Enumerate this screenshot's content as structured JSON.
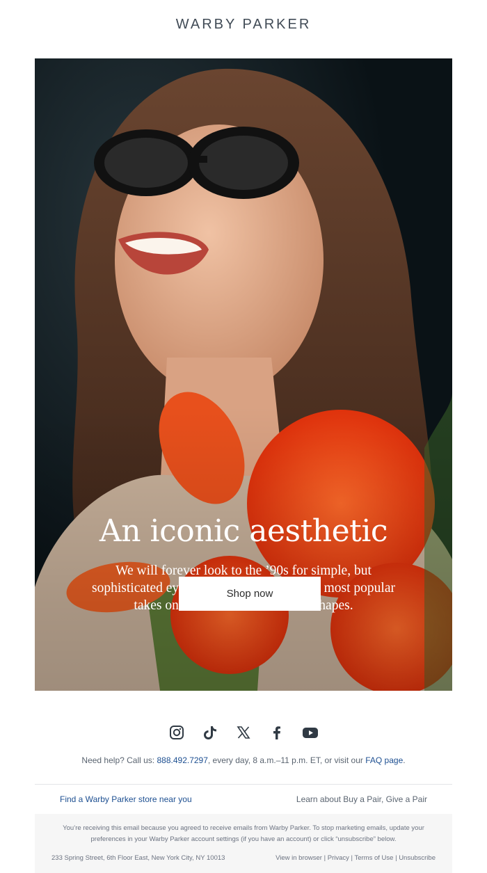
{
  "brand": {
    "logo_text": "WARBY PARKER"
  },
  "hero": {
    "title": "An iconic aesthetic",
    "body": "We will forever look to the ’90s for simple, but sophisticated eyewear inspiration. See our most popular takes on the decade’s minimalist shapes.",
    "cta_label": "Shop now"
  },
  "socials": [
    {
      "icon": "instagram-icon"
    },
    {
      "icon": "tiktok-icon"
    },
    {
      "icon": "x-icon"
    },
    {
      "icon": "facebook-icon"
    },
    {
      "icon": "youtube-icon"
    }
  ],
  "help": {
    "prefix": "Need help? Call us: ",
    "phone": "888.492.7297",
    "middle": ", every day, 8 a.m.–11 p.m. ET, or visit our ",
    "faq": "FAQ page",
    "suffix": "."
  },
  "links": {
    "store": "Find a Warby Parker store near you",
    "bapgap": "Learn about Buy a Pair, Give a Pair"
  },
  "footer": {
    "legal": "You’re receiving this email because you agreed to receive emails from Warby Parker. To stop marketing emails, update your preferences in your Warby Parker account settings (if you have an account) or click “unsubscribe” below.",
    "address": "233 Spring Street, 6th Floor East, New York City, NY 10013",
    "view_in_browser": "View in browser",
    "privacy": "Privacy",
    "terms": "Terms of Use",
    "unsubscribe": "Unsubscribe",
    "sep": " | "
  },
  "colors": {
    "text": "#414b56",
    "link": "#1d4f91",
    "legal_bg": "#f6f6f6"
  }
}
